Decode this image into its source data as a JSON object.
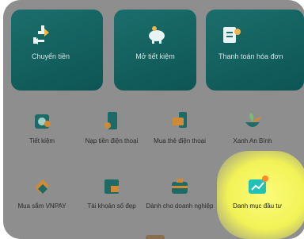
{
  "cards": [
    {
      "label": "Chuyển tiền",
      "icon": "transfer-icon"
    },
    {
      "label": "Mở tiết kiệm",
      "icon": "piggy-bank-icon"
    },
    {
      "label": "Thanh toán hóa đơn",
      "icon": "bill-icon"
    }
  ],
  "services": [
    {
      "label": "Tiết kiệm",
      "icon": "savings-icon"
    },
    {
      "label": "Nạp tiền điện thoại",
      "icon": "phone-topup-icon"
    },
    {
      "label": "Mua thẻ điện thoại",
      "icon": "phone-card-icon"
    },
    {
      "label": "Xanh An Bình",
      "icon": "green-plant-icon"
    },
    {
      "label": "Mua sắm VNPAY",
      "icon": "shopping-tag-icon"
    },
    {
      "label": "Tài khoản số đẹp",
      "icon": "account-number-icon"
    },
    {
      "label": "Dành cho doanh nghiệp",
      "icon": "briefcase-icon"
    },
    {
      "label": "Danh mục đầu tư",
      "icon": "investment-chart-icon",
      "highlighted": true
    }
  ],
  "colors": {
    "accent": "#1b6e6c",
    "highlight": "#f2f257",
    "badge": "#ff8a2a"
  }
}
